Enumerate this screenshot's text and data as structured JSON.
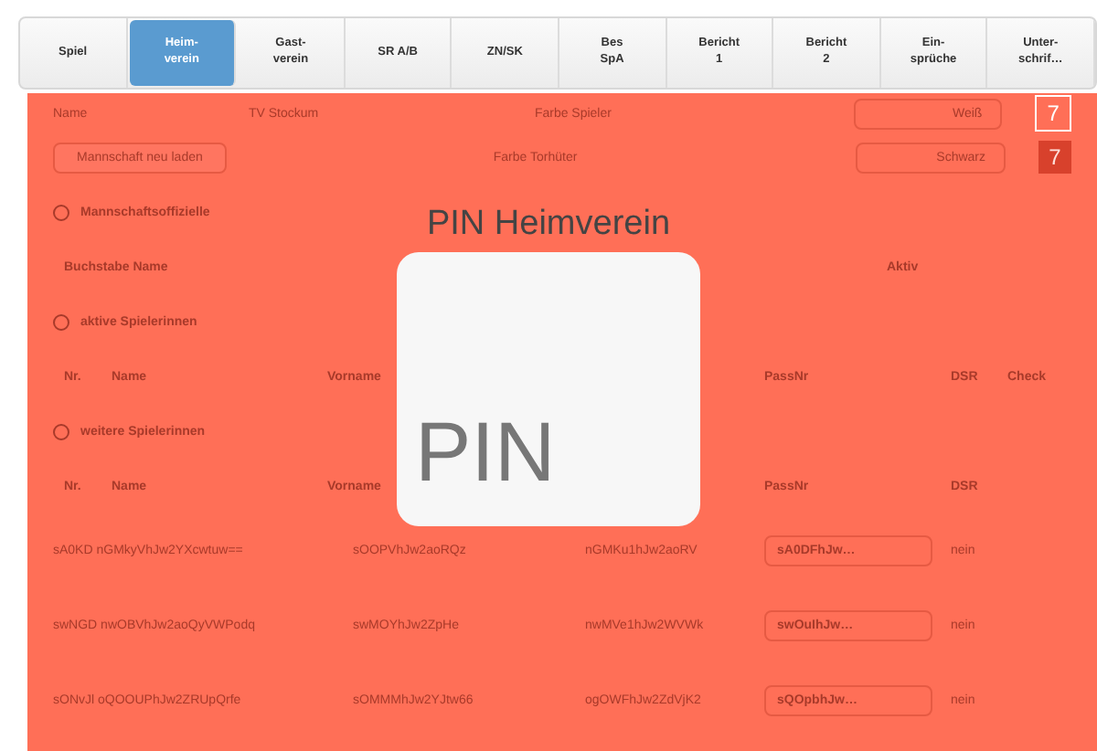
{
  "tabs": [
    {
      "label": "Spiel",
      "selected": false
    },
    {
      "label": "Heim-\nverein",
      "selected": true
    },
    {
      "label": "Gast-\nverein",
      "selected": false
    },
    {
      "label": "SR A/B",
      "selected": false
    },
    {
      "label": "ZN/SK",
      "selected": false
    },
    {
      "label": "Bes\nSpA",
      "selected": false
    },
    {
      "label": "Bericht\n1",
      "selected": false
    },
    {
      "label": "Bericht\n2",
      "selected": false
    },
    {
      "label": "Ein-\nsprüche",
      "selected": false
    },
    {
      "label": "Unter-\nschrif…",
      "selected": false
    }
  ],
  "team": {
    "name_label": "Name",
    "name_value": "TV Stockum",
    "reload_button": "Mannschaft neu laden",
    "player_color_label": "Farbe Spieler",
    "player_color": "Weiß",
    "player_number": "7",
    "keeper_color_label": "Farbe Torhüter",
    "keeper_color": "Schwarz",
    "keeper_number": "7"
  },
  "sections": [
    {
      "title": "Mannschaftsoffizielle",
      "columns": [
        "Buchstabe Name",
        "Aktiv"
      ]
    },
    {
      "title": "aktive Spielerinnen",
      "columns": [
        "Nr.",
        "Name",
        "Vorname",
        "PassNr",
        "DSR",
        "Check"
      ]
    },
    {
      "title": "weitere Spielerinnen",
      "columns": [
        "Nr.",
        "Name",
        "Vorname",
        "PassNr",
        "DSR"
      ],
      "rows": [
        {
          "name": "sA0KD nGMkyVhJw2YXcwtuw==",
          "first_name": "sOOPVhJw2aoRQz",
          "birth_year": "nGMKu1hJw2aoRV",
          "pass": "sA0DFhJw…",
          "dsr": "nein"
        },
        {
          "name": "swNGD nwOBVhJw2aoQyVWPodq",
          "first_name": "swMOYhJw2ZpHe",
          "birth_year": "nwMVe1hJw2WVWk",
          "pass": "swOuIhJw…",
          "dsr": "nein"
        },
        {
          "name": "sONvJl oQOOUPhJw2ZRUpQrfe",
          "first_name": "sOMMMhJw2YJtw66",
          "birth_year": "ogOWFhJw2ZdVjK2",
          "pass": "sQOpbhJw…",
          "dsr": "nein"
        }
      ]
    }
  ],
  "dialog": {
    "title": "PIN Heimverein",
    "pin_label": "PIN"
  }
}
